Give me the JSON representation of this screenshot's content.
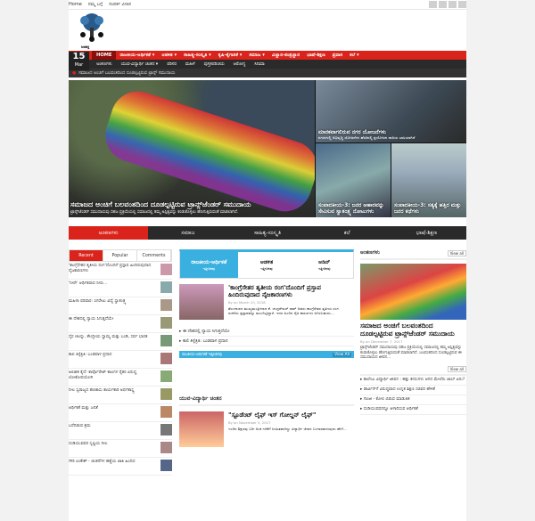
{
  "topbar": {
    "links": [
      "Home",
      "ನಮ್ಮ ಬಗ್ಗೆ",
      "ಸಂಪರ್ಕ ವಿಳಾಸ"
    ]
  },
  "logo": {
    "name": "ಜನಶಕ್ತಿ"
  },
  "date": {
    "day": "15",
    "month": "Mar"
  },
  "mainnav": {
    "home": "HOME",
    "items": [
      "ರಾಜಕೀಯ-ಆರ್ಥಿಕತೆ ▾",
      "ಆಡಳಿತ ▾",
      "ಸಾಹಿತ್ಯ-ಸಂಸ್ಕೃತಿ ▾",
      "ಕೃಷಿ-ಕೈಗಾರಿಕೆ ▾",
      "ಸಮಾಜ ▾",
      "ವಿಜ್ಞಾನ-ತಂತ್ರಜ್ಞಾನ",
      "ಭಾಷೆ-ಶಿಕ್ಷಣ",
      "ಪ್ರವಾಸ",
      "ಕಲೆ ▾"
    ]
  },
  "subnav": {
    "items": [
      "ಅಂಕಣಗಳು",
      "ಯುವ-ವಿದ್ಯಾರ್ಥಿ ಚಿಂತನ ▾",
      "ಪರಿಸರ",
      "ಮಹಿಳೆ",
      "ಪುಸ್ತಕಪರಿಚಯ",
      "ಆರೋಗ್ಯ",
      "ಸಿನಿಮಾ"
    ]
  },
  "ticker": {
    "text": "ಸಮಾಜದ ಅಂಚಿಗೆ ಬಲವಂತದಿಂದ ದೂಡಲ್ಪಟ್ಟಿರುವ ಟ್ರಾನ್ಸ್ ಸಮುದಾಯ"
  },
  "hero": {
    "main": {
      "title": "ಸಮಾಜದ ಅಂಚಿಗೆ ಬಲವಂತದಿಂದ ದೂಡಲ್ಪಟ್ಟಿರುವ ಟ್ರಾನ್ಸ್‌ಜೆಂಡರ್ ಸಮುದಾಯ",
      "summary": "ಟ್ರಾನ್ಸ್‌ಜೆಂಡರ್ ಸಮುದಾಯವು ಸಹಜ ಪ್ರಕ್ರಿಯೆಯಲ್ಲಿ ಸಮಾಜದಲ್ಲಿ ತಮ್ಮ ಅಸ್ತಿತ್ವವನ್ನು ಕಂಡುಕೊಳ್ಳಲು ಹೆಣಗುತ್ತಿರುವಂತೆ ಮಾಡಲಾಗಿದೆ."
    },
    "r1": {
      "title": "ಮಾರಕವಾಗಲಿರುವ ನಗರ ಯೋಜನೆಗಳು",
      "summary": "ನಗರಗಳಲ್ಲಿ ಅಭಿವೃದ್ಧಿ ಯೋಜನೆಗಳ ಹೆಸರಿನಲ್ಲಿ ಪ್ರಯೋಜನ ದಾರಿಯ ಬಾಸಿಯಾಗಿದೆ"
    },
    "r2": {
      "title": "ಸಂಪಾದಕೀಯ-3: ಜನರ ಆಹಾರವನ್ನು ಸೇವಿಸುವ ಸ್ವಾತಂತ್ರ್ಯ ನೋಟುಗಳು"
    },
    "r3": {
      "title": "ಸಂಪಾದಕೀಯ-3: ಸತ್ಯಕ್ಕೆ ಹತ್ತಿರ ಮತ್ತು ಜನರ ಕಥೆಗಳು"
    }
  },
  "cattabs": [
    "ಅಂಕಣಗಳು",
    "ಸಮಾಜ",
    "ಸಾಹಿತ್ಯ-ಸಂಸ್ಕೃತಿ",
    "ಕಲೆ",
    "ಭಾಷೆ-ಶಿಕ್ಷಣ"
  ],
  "left": {
    "tabs": [
      "Recent",
      "Popular",
      "Comments"
    ],
    "items": [
      "'ಕಾಂಗ್ರೆಸೇತರ ತೃತೀಯ ರಂಗ'ದೊಂದಿಗೆ ಪ್ರಸ್ತಾಪ ಹಿಂದಿರುವುದಾದ ನೈಜಕಾರಣಗಳು",
      "'ನೀರೇ' ಆರ್ಥಿಕವಾದ ನೀರು...",
      "ಮಹಿಳಾ ಪರಿವಾರ: ಸಿಗರೇಟು ವಿದ್ಯೆ ಸ್ವಾತಂತ್ರ್ಯ",
      "ಈ ದೇಶದಲ್ಲಿ ನ್ಯಾಯ ಸಿಗುತ್ತದೆಯೇ",
      "ಸೈರ ಚಲನ್ನು, ಕೇಂದ್ರೀಯ ಸ್ವಾಮ್ಯ ಮತ್ತು ಬಂಡಿ, ಸರ್ವ ಭಾರತ",
      "ಕಾಲಿ ತಿಳ್ಳೆತ್ರಿತಿ: ಬಂಡವಾಳ ಪ್ರದಾನ",
      "ಅಲಿಖಿತ ಕೈದೆ: ಕಾರ್ಪೊರೇಟ್ ಕಾಲಗಳ ರೈತರ ವಿರುದ್ಧ ಲೋಕೋಪಯೋಗಿ",
      "ನೀಲ ಸ್ವರಾಜ್ಯದ ಹಣಕಾಸು ಕಾರ್ಯಕಾರಿ ಅರ್ಥಶಾಸ್ತ್ರ",
      "ಆರ್ಥಿಕತೆ ಮತ್ತು ಜನತೆ",
      "ಬರೆದಿಡುವ ಶ್ರಮ",
      "ದುಡಿಯುವವರ ಸೃಷ್ಟಿಯ ನೀಲ",
      "ಗೌರಿ ಲಂಕೇಶ್ - ಚಿಂತನೆಗಳ ಹತ್ಯೆಯ ಜಾತಿ ಹಿಂದಿದ"
    ]
  },
  "mid": {
    "tabs": [
      {
        "label": "ರಾಜಕೀಯ-ಆರ್ಥಿಕತೆ",
        "sub": "ಇತ್ತೀಚಿನವು"
      },
      {
        "label": "ಆಡಳಿತ",
        "sub": "ಇತ್ತೀಚಿನವು"
      },
      {
        "label": "ಅಡಿನ್",
        "sub": "ಇತ್ತೀಚಿನವು"
      }
    ],
    "feature": {
      "title": "'ಕಾಂಗ್ರೆಸೇತರ ತೃತೀಯ ರಂಗ'ದೊಂದಿಗೆ ಪ್ರಸ್ತಾಪ ಹಿಂದಿರುವುದಾದ ನೈಜಕಾರಣಗಳು",
      "meta": "By on March 10, 2018",
      "summary": "ತೆಲಂಗಾಣದ ಮುಖ್ಯಮಂತ್ರಿಗಳಾದ ಕೆ. ಚಂದ್ರಶೇಖರ್ ರಾವ್ ಅವರು ಕಾಂಗ್ರೆಸೇತರ ತೃತೀಯ ರಂಗ ರಚನೆಯ ಪ್ರಸ್ತಾಪವನ್ನು ಮುಂದಿಟ್ಟಿದ್ದಾರೆ. ಇದರ ಹಿಂದಿನ ನೈಜ ಕಾರಣಗಳು ಏನಿರಬಹುದು..."
    },
    "minis": [
      "ಈ ದೇಶದಲ್ಲಿ ನ್ಯಾಯ ಸಿಗುತ್ತದೆಯೇ",
      "ಕಾಲಿ ತಿಳ್ಳೆತ್ರಿತಿ: ಬಂಡವಾಳ ಪ್ರದಾನ"
    ],
    "bluebar": "ರಾಜಕೀಯ-ಆರ್ಥಿಕತೆ ಇತ್ತೀಚಿನವು",
    "viewall": "View All",
    "section2": "ಯುವ-ವಿದ್ಯಾರ್ಥಿ ಚಿಂತನ",
    "feature2": {
      "title": "\"ಸ್ಟೂಡೆಂಟ್ ಲೈಫ್ ಇಸ್ ಗೋಲ್ಡನ್ ಲೈಫ್\"",
      "meta": "By on November 5, 2017",
      "summary": "ಇಂದಿನ ಶಿಕ್ಷಣವು ಬರೀ ಅಂಕ ಗಳಿಕೆಗೆ ಸೀಮಿತವಾಗಿದ್ದು ವಿದ್ಯಾರ್ಥಿ ಜೀವನ ಬಂಗಾರವಾಗುವುದು ಹೇಗೆ..."
    }
  },
  "right": {
    "head": "ಅಂಕಣಗಳು",
    "viewall": "View all",
    "title": "ಸಮಾಜದ ಅಂಚಿಗೆ ಬಲವಂತದಿಂದ ದೂಡಲ್ಪಟ್ಟಿರುವ ಟ್ರಾನ್ಸ್‌ಜೆಂಡರ್ ಸಮುದಾಯ",
    "meta": "By on December 7, 2017",
    "summary": "ಟ್ರಾನ್ಸ್‌ಜೆಂಡರ್ ಸಮುದಾಯವು ಸಹಜ ಪ್ರಕ್ರಿಯೆಯಲ್ಲಿ ಸಮಾಜದಲ್ಲಿ ತಮ್ಮ ಅಸ್ತಿತ್ವವನ್ನು ಕಂಡುಕೊಳ್ಳಲು ಹೆಣಗುತ್ತಿರುವಂತೆ ಮಾಡಲಾಗಿದೆ. ಬಲವಂತದಿಂದ ದೂಡಲ್ಪಟ್ಟಿರುವ ಈ ಸಮುದಾಯದ ಜೀವನ...",
    "viewall2": "View all",
    "bullets": [
      "ಕಾಲೇಜು ವಿದ್ಯಾರ್ಥಿ ಜೀವನ : ಹತ್ತು ಕನಸುಗಳು ಆಗದ ಮೇಲೆರು ಜಾಬ್ ಏನು?",
      "ಡಾರ್ವಿನ್‌ಗೆ ವಿರುದ್ಧವಾದ ಉನ್ನತ ಶಿಕ್ಷಣ ಸಚಿವರ ಹೇಳಿಕೆ",
      "ಗಾಂಜಿ - ಕೋಲಿ ಬಿಡುವ ಮಾಡುತಿತ",
      "ದುಡಿಯುವವರನ್ನೂ ಆಳಾದಿಸುವ ಆರ್ಥಿಕತೆ"
    ]
  }
}
